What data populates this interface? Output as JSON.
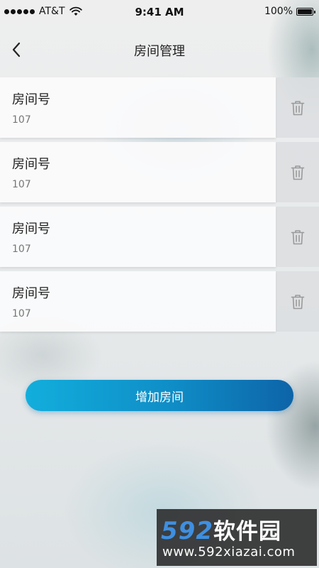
{
  "status_bar": {
    "carrier": "AT&T",
    "time": "9:41 AM",
    "battery": "100%"
  },
  "nav": {
    "title": "房间管理",
    "back_icon": "chevron-left-icon"
  },
  "rooms": [
    {
      "label": "房间号",
      "number": "107"
    },
    {
      "label": "房间号",
      "number": "107"
    },
    {
      "label": "房间号",
      "number": "107"
    },
    {
      "label": "房间号",
      "number": "107"
    }
  ],
  "delete_icon": "trash-icon",
  "add_button": {
    "label": "增加房间"
  },
  "watermark": {
    "logo_number": "592",
    "logo_text": "软件园",
    "url": "www.592xiazai.com"
  },
  "colors": {
    "button_start": "#12aedc",
    "button_end": "#0d64a8",
    "watermark_blue": "#3e8fe0"
  }
}
